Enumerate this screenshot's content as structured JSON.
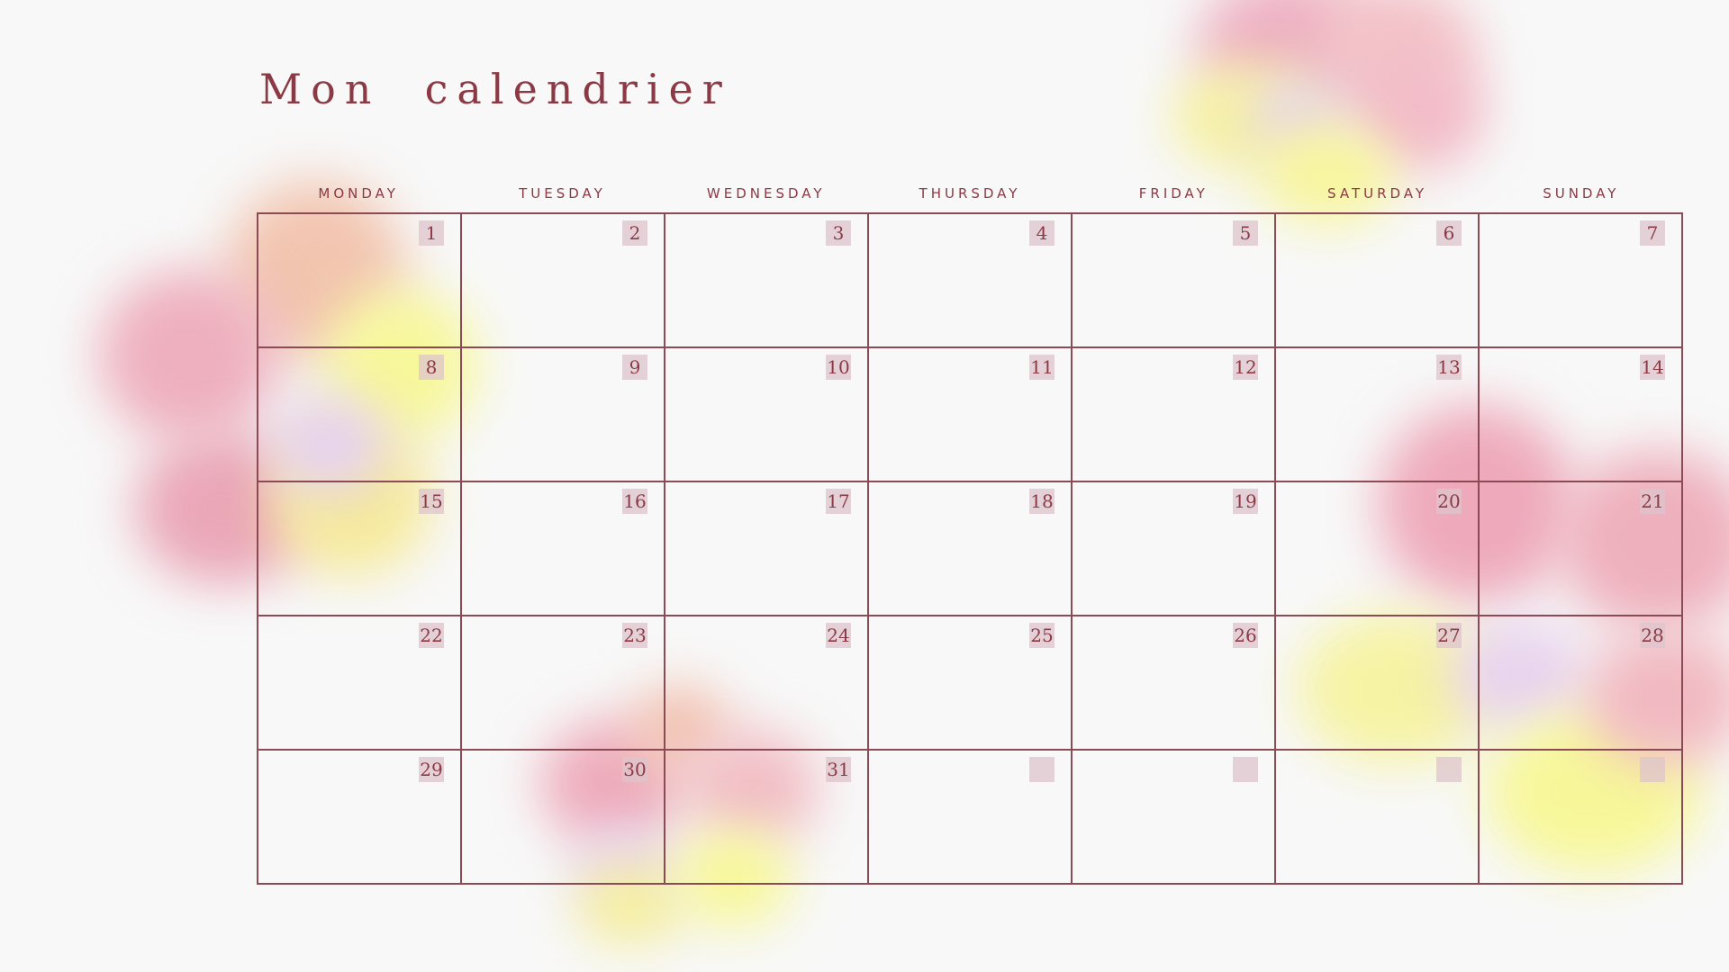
{
  "title": "Mon  calendrier",
  "weekdays": [
    "MONDAY",
    "TUESDAY",
    "WEDNESDAY",
    "THURSDAY",
    "FRIDAY",
    "SATURDAY",
    "SUNDAY"
  ],
  "weeks": [
    [
      "1",
      "2",
      "3",
      "4",
      "5",
      "6",
      "7"
    ],
    [
      "8",
      "9",
      "10",
      "11",
      "12",
      "13",
      "14"
    ],
    [
      "15",
      "16",
      "17",
      "18",
      "19",
      "20",
      "21"
    ],
    [
      "22",
      "23",
      "24",
      "25",
      "26",
      "27",
      "28"
    ],
    [
      "29",
      "30",
      "31",
      "",
      "",
      "",
      ""
    ]
  ],
  "colors": {
    "accent": "#8b3a45",
    "grid_line": "#8b4a54",
    "day_badge": "#dec4cc",
    "background": "#f8f8f8",
    "blob_pink": "#eeaabb",
    "blob_yellow": "#f6f59a",
    "blob_lavender": "#e6d2ee"
  }
}
